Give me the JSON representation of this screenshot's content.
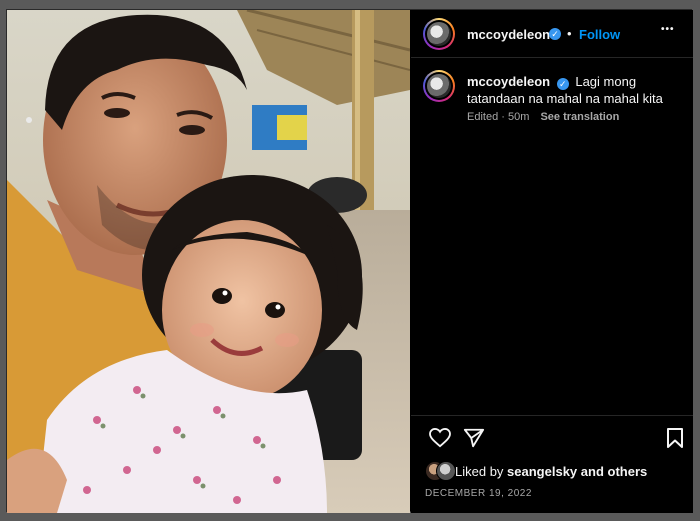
{
  "post": {
    "username": "mccoydeleon",
    "follow_label": "Follow",
    "separator": "•",
    "more_label": "•••",
    "caption_username": "mccoydeleon",
    "caption_text": "Lagi mong tatandaan na mahal na mahal kita",
    "edited_label": "Edited · 50m",
    "see_translation_label": "See translation",
    "liked_by_prefix": "Liked by",
    "liked_by_user": "seangelsky",
    "liked_by_suffix": "and others",
    "date": "DECEMBER 19, 2022"
  },
  "icons": {
    "like": "heart-icon",
    "share": "paper-plane-icon",
    "save": "bookmark-icon",
    "verified": "verified-badge-icon",
    "more": "more-options-icon"
  },
  "colors": {
    "accent": "#0095f6",
    "verified": "#3897f0",
    "background": "#000000",
    "muted_text": "#a8a8a8"
  }
}
